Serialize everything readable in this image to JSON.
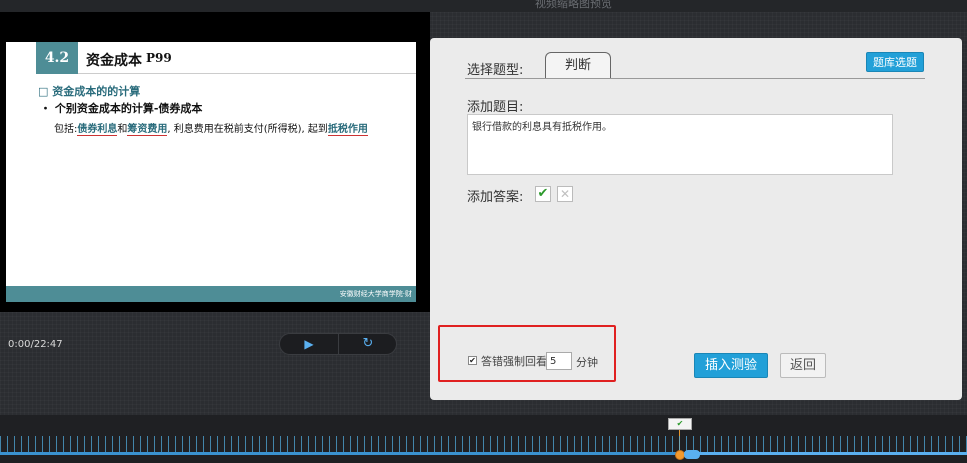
{
  "top_hint": "视频缩略图预览",
  "slide": {
    "number": "4.2",
    "title": "资金成本",
    "page": "P99",
    "heading": "□ 资金成本的的计算",
    "subheading": "・ 个别资金成本的计算-债券成本",
    "line_prefix": "包括:",
    "term1": "债券利息",
    "conj": "和",
    "term2": "筹资费用",
    "line_mid": ", 利息费用在税前支付(所得税), 起到",
    "term3": "抵税作用",
    "footer": "安徽财经大学商学院·财"
  },
  "player": {
    "time": "0:00/22:47",
    "play_icon": "play-icon",
    "replay_icon": "replay-icon"
  },
  "panel": {
    "question_type_label": "选择题型:",
    "question_type_tab": "判断",
    "bank_button": "题库选题",
    "add_question_label": "添加题目:",
    "question_text": "银行借款的利息具有抵税作用。",
    "add_answer_label": "添加答案:",
    "answer_true_symbol": "✔",
    "answer_false_symbol": "✕",
    "force_review_label": "答错强制回看",
    "force_review_checked": true,
    "minutes_value": "5",
    "minutes_unit": "分钟",
    "insert_button": "插入测验",
    "back_button": "返回"
  },
  "timeline": {
    "marker_symbol": "✔",
    "colors": {
      "accent": "#22a0d8",
      "handle": "#f29a2e",
      "highlight_box": "#e02020"
    }
  }
}
